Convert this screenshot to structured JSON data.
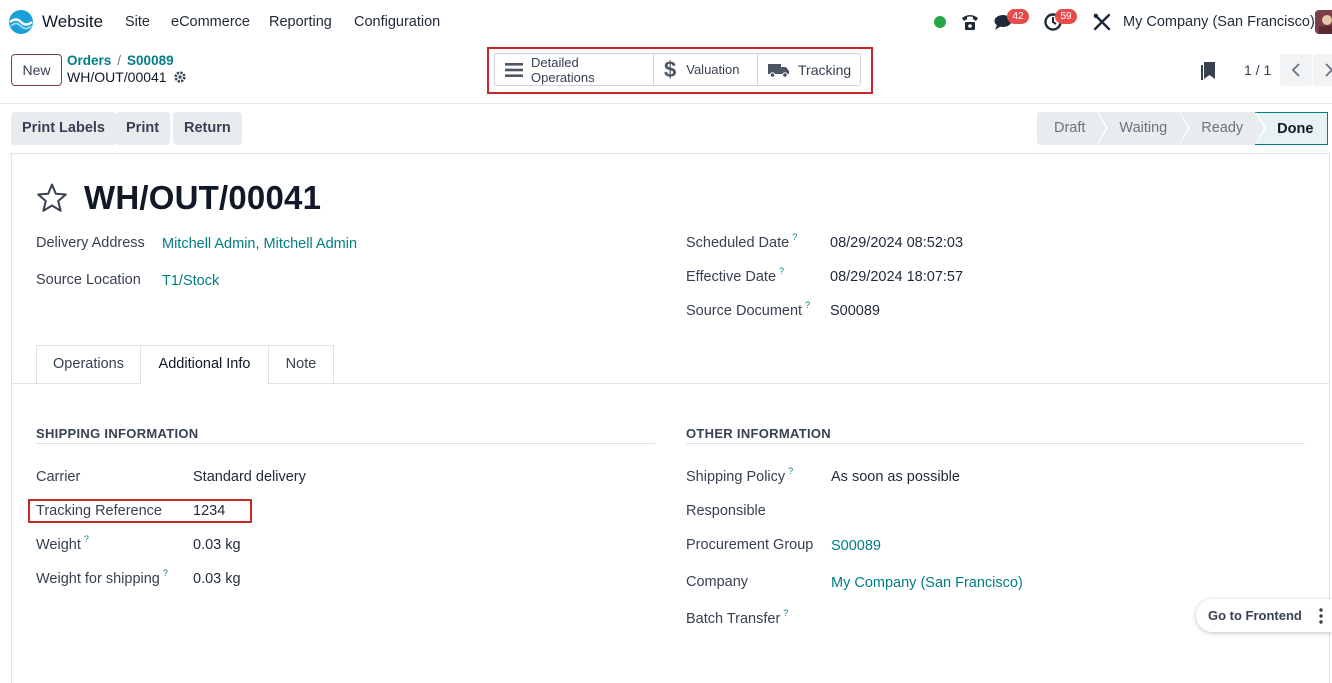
{
  "navbar": {
    "app_name": "Website",
    "menu": [
      "Site",
      "eCommerce",
      "Reporting",
      "Configuration"
    ],
    "messages_count": "42",
    "activities_count": "59",
    "company": "My Company (San Francisco)"
  },
  "control_panel": {
    "new_label": "New",
    "breadcrumb": [
      "Orders",
      "S00089"
    ],
    "current_record": "WH/OUT/00041",
    "smart_buttons": [
      "Detailed Operations",
      "Valuation",
      "Tracking"
    ],
    "pager": "1 / 1"
  },
  "statusbar": {
    "actions": [
      "Print Labels",
      "Print",
      "Return"
    ],
    "stages": [
      "Draft",
      "Waiting",
      "Ready",
      "Done"
    ],
    "active_stage": "Done"
  },
  "form": {
    "title": "WH/OUT/00041",
    "delivery_address_label": "Delivery Address",
    "delivery_address": "Mitchell Admin, Mitchell Admin",
    "source_location_label": "Source Location",
    "source_location": "T1/Stock",
    "scheduled_date_label": "Scheduled Date",
    "scheduled_date": "08/29/2024 08:52:03",
    "effective_date_label": "Effective Date",
    "effective_date": "08/29/2024 18:07:57",
    "source_document_label": "Source Document",
    "source_document": "S00089",
    "help_mark": "?"
  },
  "tabs": [
    "Operations",
    "Additional Info",
    "Note"
  ],
  "active_tab": "Additional Info",
  "shipping": {
    "heading": "SHIPPING INFORMATION",
    "carrier_label": "Carrier",
    "carrier": "Standard delivery",
    "tracking_label": "Tracking Reference",
    "tracking": "1234",
    "weight_label": "Weight",
    "weight": "0.03",
    "weight_shipping_label": "Weight for shipping",
    "weight_shipping": "0.03",
    "unit": "kg"
  },
  "other": {
    "heading": "OTHER INFORMATION",
    "policy_label": "Shipping Policy",
    "policy": "As soon as possible",
    "responsible_label": "Responsible",
    "procurement_label": "Procurement Group",
    "procurement": "S00089",
    "company_label": "Company",
    "company": "My Company (San Francisco)",
    "batch_label": "Batch Transfer"
  },
  "frontend_button": "Go to Frontend",
  "colors": {
    "accent": "#017e84",
    "brand": "#7b3f4a",
    "highlight": "#c62828",
    "badge": "#e74c4c"
  }
}
